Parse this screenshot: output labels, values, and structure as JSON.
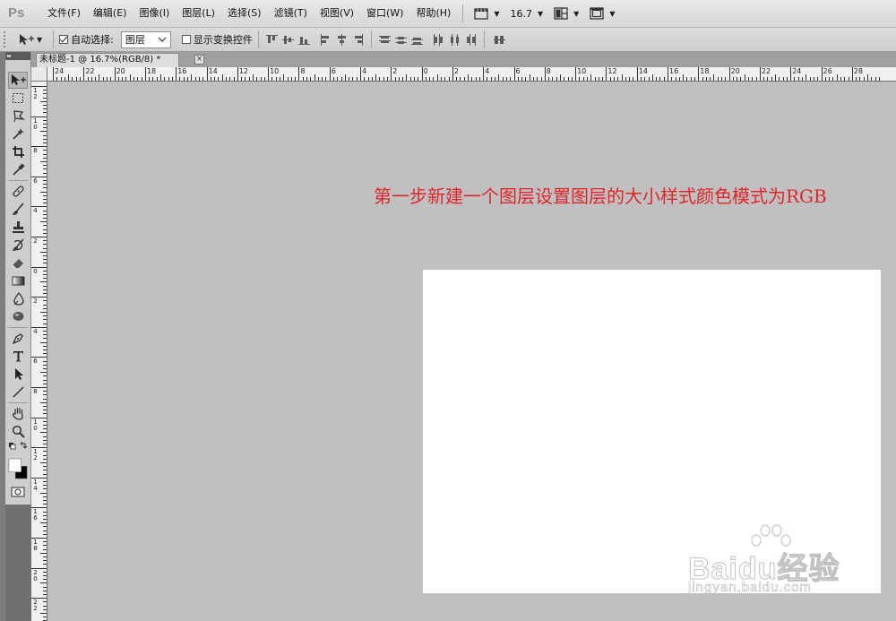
{
  "app": {
    "logo": "Ps"
  },
  "menu": {
    "items": [
      "文件(F)",
      "编辑(E)",
      "图像(I)",
      "图层(L)",
      "选择(S)",
      "滤镜(T)",
      "视图(V)",
      "窗口(W)",
      "帮助(H)"
    ],
    "zoom_value": "16.7"
  },
  "options": {
    "auto_select_label": "自动选择:",
    "auto_select_checked": true,
    "auto_select_target": "图层",
    "show_transform_label": "显示变换控件",
    "show_transform_checked": false
  },
  "document": {
    "tab_title": "未标题-1 @ 16.7%(RGB/8) *",
    "close_glyph": "×",
    "annotation": "第一步新建一个图层设置图层的大小样式颜色模式为RGB",
    "canvas_color": "#ffffff",
    "workspace_color": "#c0c0c0"
  },
  "rulers": {
    "horizontal_labels": [
      "24",
      "22",
      "20",
      "18",
      "16",
      "14",
      "12",
      "10",
      "8",
      "6",
      "4",
      "2",
      "0",
      "2",
      "4",
      "6",
      "8",
      "10",
      "12",
      "14",
      "16",
      "18",
      "20",
      "22",
      "24",
      "26",
      "28"
    ],
    "vertical_labels": [
      "1\n2",
      "1\n0",
      "8",
      "6",
      "4",
      "2",
      "0",
      "2",
      "4",
      "6",
      "8",
      "1\n0",
      "1\n2",
      "1\n4",
      "1\n6",
      "1\n8",
      "2\n0",
      "2\n2"
    ]
  },
  "watermark": {
    "logo_text": "Baidu经验",
    "url": "jingyan.baidu.com"
  },
  "colors": {
    "annotation": "#e0262b",
    "accent_menu_bg": "#dcdcdc"
  }
}
